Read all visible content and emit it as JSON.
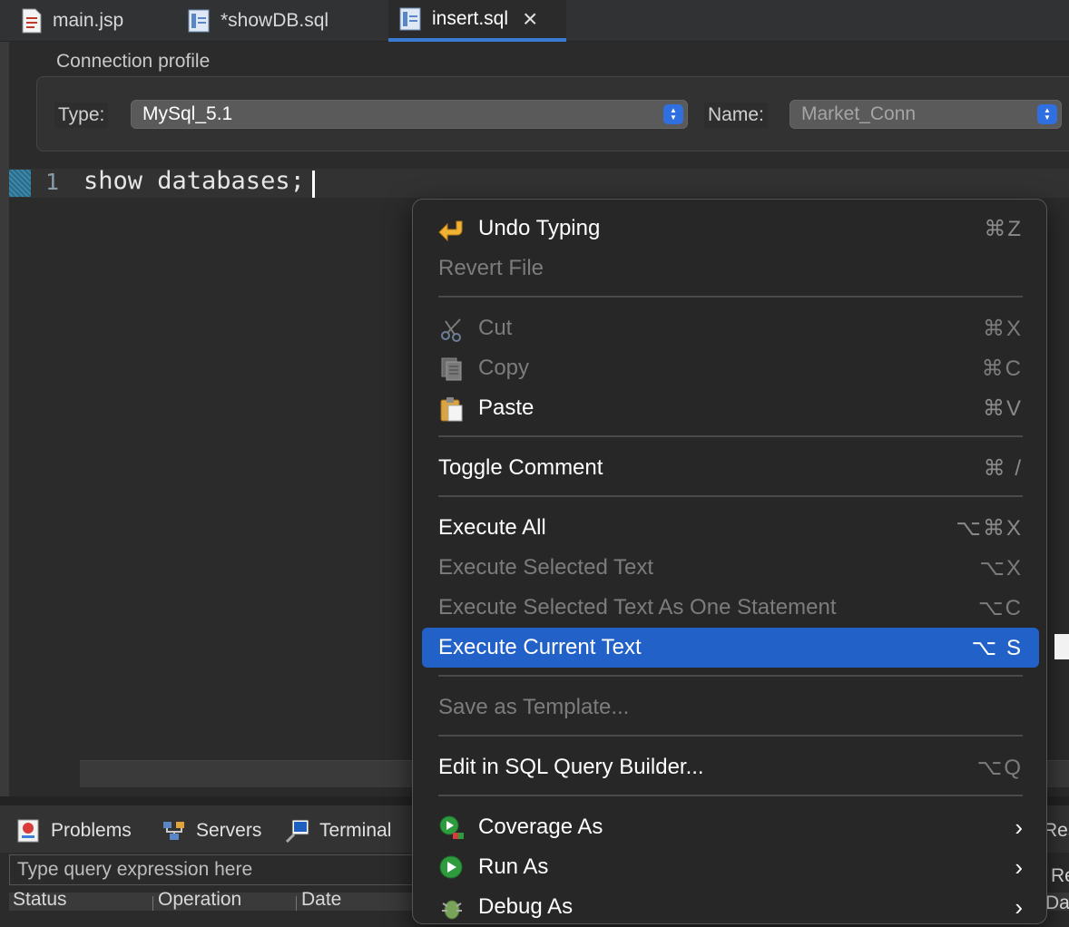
{
  "tabs": [
    {
      "label": "main.jsp",
      "icon": "jsp-file-icon"
    },
    {
      "label": "*showDB.sql",
      "icon": "sql-file-icon"
    },
    {
      "label": "insert.sql",
      "icon": "sql-file-icon",
      "active": true
    }
  ],
  "connection": {
    "title": "Connection profile",
    "type_label": "Type:",
    "type_value": "MySql_5.1",
    "name_label": "Name:",
    "name_value": "Market_Conn"
  },
  "editor": {
    "line_number": "1",
    "code": "show databases;"
  },
  "context_menu": {
    "items": [
      {
        "label": "Undo Typing",
        "shortcut": "⌘Z",
        "enabled": true,
        "icon": "undo-icon"
      },
      {
        "label": "Revert File",
        "shortcut": "",
        "enabled": false
      },
      {
        "label": "Cut",
        "shortcut": "⌘X",
        "enabled": false,
        "icon": "scissors-icon"
      },
      {
        "label": "Copy",
        "shortcut": "⌘C",
        "enabled": false,
        "icon": "copy-icon"
      },
      {
        "label": "Paste",
        "shortcut": "⌘V",
        "enabled": true,
        "icon": "clipboard-icon"
      },
      {
        "label": "Toggle Comment",
        "shortcut": "⌘ /",
        "enabled": true
      },
      {
        "label": "Execute All",
        "shortcut": "⌥⌘X",
        "enabled": true
      },
      {
        "label": "Execute Selected Text",
        "shortcut": "⌥X",
        "enabled": false
      },
      {
        "label": "Execute Selected Text As One Statement",
        "shortcut": "⌥C",
        "enabled": false
      },
      {
        "label": "Execute Current Text",
        "shortcut": "⌥ S",
        "enabled": true,
        "highlighted": true
      },
      {
        "label": "Save as Template...",
        "shortcut": "",
        "enabled": false
      },
      {
        "label": "Edit in SQL Query Builder...",
        "shortcut": "⌥Q",
        "enabled": false
      },
      {
        "label": "Coverage As",
        "submenu": true,
        "icon": "coverage-icon"
      },
      {
        "label": "Run As",
        "submenu": true,
        "icon": "run-icon"
      },
      {
        "label": "Debug As",
        "submenu": true,
        "icon": "debug-icon"
      }
    ]
  },
  "bottom_panel": {
    "tabs": [
      {
        "label": "Problems",
        "icon": "problems-icon"
      },
      {
        "label": "Servers",
        "icon": "servers-icon"
      },
      {
        "label": "Terminal",
        "icon": "terminal-icon"
      }
    ],
    "query_placeholder": "Type query expression here",
    "columns": [
      "Status",
      "Operation",
      "Date"
    ],
    "right_fragments": [
      "Res",
      "Re",
      "Data"
    ]
  },
  "colors": {
    "background": "#2b2b2b",
    "menu_background": "#272727",
    "highlight": "#2261c7",
    "select_accent": "#2f6fe0"
  }
}
